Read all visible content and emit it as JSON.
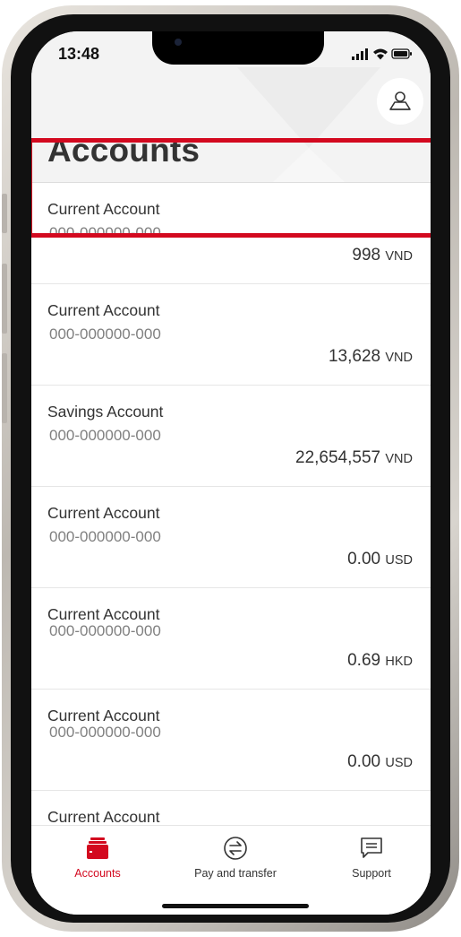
{
  "status_bar": {
    "time": "13:48"
  },
  "header": {
    "title": "Accounts",
    "profile_icon": "person-outline-icon"
  },
  "accounts": [
    {
      "name": "Current Account",
      "number": "000-000000-000",
      "amount": "998",
      "currency": "VND"
    },
    {
      "name": "Current Account",
      "number": "000-000000-000",
      "amount": "13,628",
      "currency": "VND"
    },
    {
      "name": "Savings Account",
      "number": "000-000000-000",
      "amount": "22,654,557",
      "currency": "VND"
    },
    {
      "name": "Current Account",
      "number": "000-000000-000",
      "amount": "0.00",
      "currency": "USD"
    },
    {
      "name": "Current Account",
      "number": "000-000000-000",
      "amount": "0.69",
      "currency": "HKD"
    },
    {
      "name": "Current Account",
      "number": "000-000000-000",
      "amount": "0.00",
      "currency": "USD"
    },
    {
      "name": "Current Account"
    }
  ],
  "tabbar": {
    "items": [
      {
        "label": "Accounts",
        "icon": "wallet-icon",
        "active": true
      },
      {
        "label": "Pay and transfer",
        "icon": "transfer-arrows-icon",
        "active": false
      },
      {
        "label": "Support",
        "icon": "chat-icon",
        "active": false
      }
    ]
  },
  "colors": {
    "brand_red": "#d3091f",
    "text": "#333333",
    "muted": "#808080",
    "header_bg": "#f3f3f3"
  }
}
